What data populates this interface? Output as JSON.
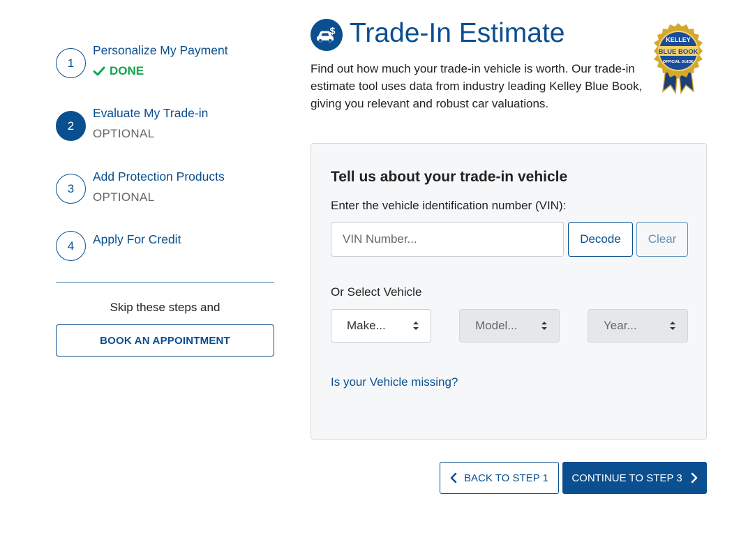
{
  "steps": [
    {
      "number": "1",
      "title": "Personalize My Payment",
      "status": "DONE"
    },
    {
      "number": "2",
      "title": "Evaluate My Trade-in",
      "status": "OPTIONAL",
      "active": true
    },
    {
      "number": "3",
      "title": "Add Protection Products",
      "status": "OPTIONAL"
    },
    {
      "number": "4",
      "title": "Apply For Credit",
      "status": ""
    }
  ],
  "sidebar": {
    "skip_text": "Skip these steps and",
    "book_button": "BOOK AN APPOINTMENT"
  },
  "header": {
    "icon": "car-dollar-icon",
    "title": "Trade-In Estimate",
    "description": "Find out how much your trade-in vehicle is worth. Our trade-in estimate tool uses data from industry leading Kelley Blue Book, giving you relevant and robust car valuations.",
    "badge": {
      "top": "KELLEY",
      "middle": "BLUE BOOK",
      "bottom": "OFFICIAL GUIDE"
    }
  },
  "card": {
    "title": "Tell us about your trade-in vehicle",
    "vin_label": "Enter the vehicle identification number (VIN):",
    "vin_placeholder": "VIN Number...",
    "vin_value": "",
    "decode_button": "Decode",
    "clear_button": "Clear",
    "or_label": "Or Select Vehicle",
    "selects": {
      "make": "Make...",
      "model": "Model...",
      "year": "Year..."
    },
    "missing_link": "Is your Vehicle missing?"
  },
  "nav": {
    "back_button": "BACK TO STEP 1",
    "next_button": "CONTINUE TO STEP 3"
  },
  "colors": {
    "primary": "#0a4f8f",
    "done": "#14a44d",
    "muted": "#666666",
    "card_bg": "#f6f7f9"
  }
}
